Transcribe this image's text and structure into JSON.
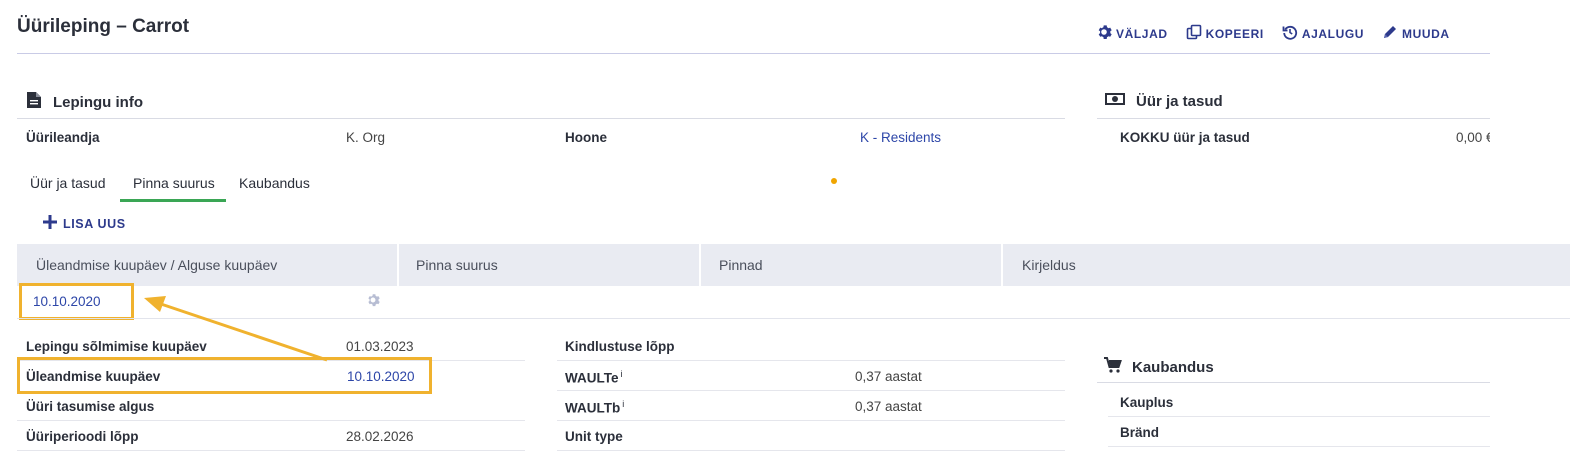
{
  "page": {
    "title": "Üürileping – Carrot"
  },
  "toolbar": {
    "fields": "VÄLJAD",
    "copy": "KOPEERI",
    "history": "AJALUGU",
    "edit": "MUUDA"
  },
  "contract_info": {
    "title": "Lepingu info",
    "landlord_label": "Üürileandja",
    "landlord_value": "K. Org",
    "building_label": "Hoone",
    "building_value": "K - Residents"
  },
  "rent": {
    "title": "Üür ja tasud",
    "total_label": "KOKKU üür ja tasud",
    "total_value": "0,00 €"
  },
  "tabs": [
    {
      "label": "Üür ja tasud",
      "active": false
    },
    {
      "label": "Pinna suurus",
      "active": true
    },
    {
      "label": "Kaubandus",
      "active": false
    }
  ],
  "add_new": "LISA UUS",
  "table": {
    "headers": [
      "Üleandmise kuupäev / Alguse kuupäev",
      "Pinna suurus",
      "Pinnad",
      "Kirjeldus"
    ],
    "rows": [
      {
        "date": "10.10.2020"
      }
    ]
  },
  "details_left": [
    {
      "label": "Lepingu sõlmimise kuupäev",
      "value": "01.03.2023"
    },
    {
      "label": "Üleandmise kuupäev",
      "value": "10.10.2020"
    },
    {
      "label": "Üüri tasumise algus",
      "value": ""
    },
    {
      "label": "Üüriperioodi lõpp",
      "value": "28.02.2026"
    }
  ],
  "details_mid": [
    {
      "label": "Kindlustuse lõpp",
      "value": ""
    },
    {
      "label": "WAULTe",
      "sup": "i",
      "value": "0,37 aastat"
    },
    {
      "label": "WAULTb",
      "sup": "i",
      "value": "0,37 aastat"
    },
    {
      "label": "Unit type",
      "value": ""
    }
  ],
  "trade": {
    "title": "Kaubandus",
    "rows": [
      {
        "label": "Kauplus"
      },
      {
        "label": "Bränd"
      }
    ]
  },
  "colors": {
    "accent": "#2d3a8c",
    "link": "#2d46a8",
    "highlight": "#f0b22e",
    "tab_active": "#3aa655"
  }
}
